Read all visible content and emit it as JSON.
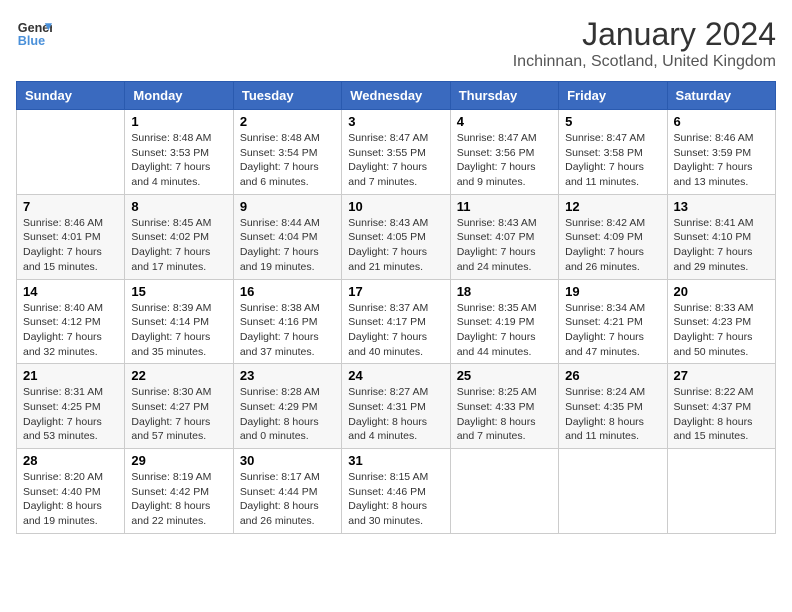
{
  "header": {
    "logo_line1": "General",
    "logo_line2": "Blue",
    "title": "January 2024",
    "subtitle": "Inchinnan, Scotland, United Kingdom"
  },
  "days_of_week": [
    "Sunday",
    "Monday",
    "Tuesday",
    "Wednesday",
    "Thursday",
    "Friday",
    "Saturday"
  ],
  "weeks": [
    [
      {
        "date": "",
        "sunrise": "",
        "sunset": "",
        "daylight": ""
      },
      {
        "date": "1",
        "sunrise": "Sunrise: 8:48 AM",
        "sunset": "Sunset: 3:53 PM",
        "daylight": "Daylight: 7 hours and 4 minutes."
      },
      {
        "date": "2",
        "sunrise": "Sunrise: 8:48 AM",
        "sunset": "Sunset: 3:54 PM",
        "daylight": "Daylight: 7 hours and 6 minutes."
      },
      {
        "date": "3",
        "sunrise": "Sunrise: 8:47 AM",
        "sunset": "Sunset: 3:55 PM",
        "daylight": "Daylight: 7 hours and 7 minutes."
      },
      {
        "date": "4",
        "sunrise": "Sunrise: 8:47 AM",
        "sunset": "Sunset: 3:56 PM",
        "daylight": "Daylight: 7 hours and 9 minutes."
      },
      {
        "date": "5",
        "sunrise": "Sunrise: 8:47 AM",
        "sunset": "Sunset: 3:58 PM",
        "daylight": "Daylight: 7 hours and 11 minutes."
      },
      {
        "date": "6",
        "sunrise": "Sunrise: 8:46 AM",
        "sunset": "Sunset: 3:59 PM",
        "daylight": "Daylight: 7 hours and 13 minutes."
      }
    ],
    [
      {
        "date": "7",
        "sunrise": "Sunrise: 8:46 AM",
        "sunset": "Sunset: 4:01 PM",
        "daylight": "Daylight: 7 hours and 15 minutes."
      },
      {
        "date": "8",
        "sunrise": "Sunrise: 8:45 AM",
        "sunset": "Sunset: 4:02 PM",
        "daylight": "Daylight: 7 hours and 17 minutes."
      },
      {
        "date": "9",
        "sunrise": "Sunrise: 8:44 AM",
        "sunset": "Sunset: 4:04 PM",
        "daylight": "Daylight: 7 hours and 19 minutes."
      },
      {
        "date": "10",
        "sunrise": "Sunrise: 8:43 AM",
        "sunset": "Sunset: 4:05 PM",
        "daylight": "Daylight: 7 hours and 21 minutes."
      },
      {
        "date": "11",
        "sunrise": "Sunrise: 8:43 AM",
        "sunset": "Sunset: 4:07 PM",
        "daylight": "Daylight: 7 hours and 24 minutes."
      },
      {
        "date": "12",
        "sunrise": "Sunrise: 8:42 AM",
        "sunset": "Sunset: 4:09 PM",
        "daylight": "Daylight: 7 hours and 26 minutes."
      },
      {
        "date": "13",
        "sunrise": "Sunrise: 8:41 AM",
        "sunset": "Sunset: 4:10 PM",
        "daylight": "Daylight: 7 hours and 29 minutes."
      }
    ],
    [
      {
        "date": "14",
        "sunrise": "Sunrise: 8:40 AM",
        "sunset": "Sunset: 4:12 PM",
        "daylight": "Daylight: 7 hours and 32 minutes."
      },
      {
        "date": "15",
        "sunrise": "Sunrise: 8:39 AM",
        "sunset": "Sunset: 4:14 PM",
        "daylight": "Daylight: 7 hours and 35 minutes."
      },
      {
        "date": "16",
        "sunrise": "Sunrise: 8:38 AM",
        "sunset": "Sunset: 4:16 PM",
        "daylight": "Daylight: 7 hours and 37 minutes."
      },
      {
        "date": "17",
        "sunrise": "Sunrise: 8:37 AM",
        "sunset": "Sunset: 4:17 PM",
        "daylight": "Daylight: 7 hours and 40 minutes."
      },
      {
        "date": "18",
        "sunrise": "Sunrise: 8:35 AM",
        "sunset": "Sunset: 4:19 PM",
        "daylight": "Daylight: 7 hours and 44 minutes."
      },
      {
        "date": "19",
        "sunrise": "Sunrise: 8:34 AM",
        "sunset": "Sunset: 4:21 PM",
        "daylight": "Daylight: 7 hours and 47 minutes."
      },
      {
        "date": "20",
        "sunrise": "Sunrise: 8:33 AM",
        "sunset": "Sunset: 4:23 PM",
        "daylight": "Daylight: 7 hours and 50 minutes."
      }
    ],
    [
      {
        "date": "21",
        "sunrise": "Sunrise: 8:31 AM",
        "sunset": "Sunset: 4:25 PM",
        "daylight": "Daylight: 7 hours and 53 minutes."
      },
      {
        "date": "22",
        "sunrise": "Sunrise: 8:30 AM",
        "sunset": "Sunset: 4:27 PM",
        "daylight": "Daylight: 7 hours and 57 minutes."
      },
      {
        "date": "23",
        "sunrise": "Sunrise: 8:28 AM",
        "sunset": "Sunset: 4:29 PM",
        "daylight": "Daylight: 8 hours and 0 minutes."
      },
      {
        "date": "24",
        "sunrise": "Sunrise: 8:27 AM",
        "sunset": "Sunset: 4:31 PM",
        "daylight": "Daylight: 8 hours and 4 minutes."
      },
      {
        "date": "25",
        "sunrise": "Sunrise: 8:25 AM",
        "sunset": "Sunset: 4:33 PM",
        "daylight": "Daylight: 8 hours and 7 minutes."
      },
      {
        "date": "26",
        "sunrise": "Sunrise: 8:24 AM",
        "sunset": "Sunset: 4:35 PM",
        "daylight": "Daylight: 8 hours and 11 minutes."
      },
      {
        "date": "27",
        "sunrise": "Sunrise: 8:22 AM",
        "sunset": "Sunset: 4:37 PM",
        "daylight": "Daylight: 8 hours and 15 minutes."
      }
    ],
    [
      {
        "date": "28",
        "sunrise": "Sunrise: 8:20 AM",
        "sunset": "Sunset: 4:40 PM",
        "daylight": "Daylight: 8 hours and 19 minutes."
      },
      {
        "date": "29",
        "sunrise": "Sunrise: 8:19 AM",
        "sunset": "Sunset: 4:42 PM",
        "daylight": "Daylight: 8 hours and 22 minutes."
      },
      {
        "date": "30",
        "sunrise": "Sunrise: 8:17 AM",
        "sunset": "Sunset: 4:44 PM",
        "daylight": "Daylight: 8 hours and 26 minutes."
      },
      {
        "date": "31",
        "sunrise": "Sunrise: 8:15 AM",
        "sunset": "Sunset: 4:46 PM",
        "daylight": "Daylight: 8 hours and 30 minutes."
      },
      {
        "date": "",
        "sunrise": "",
        "sunset": "",
        "daylight": ""
      },
      {
        "date": "",
        "sunrise": "",
        "sunset": "",
        "daylight": ""
      },
      {
        "date": "",
        "sunrise": "",
        "sunset": "",
        "daylight": ""
      }
    ]
  ]
}
